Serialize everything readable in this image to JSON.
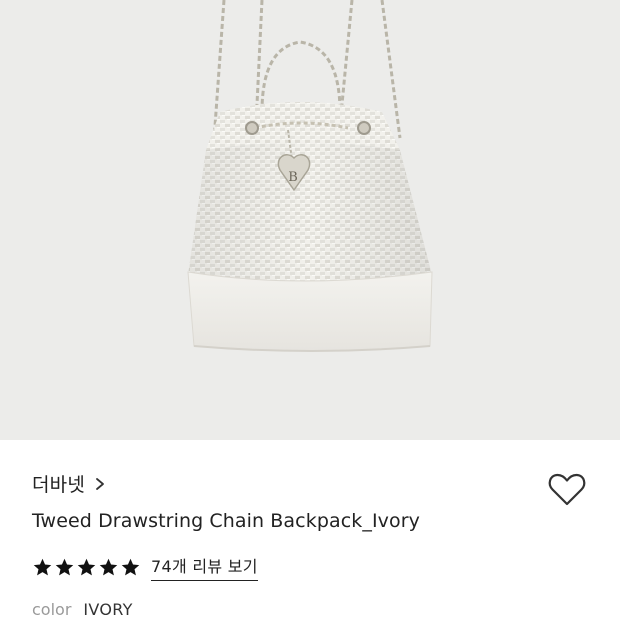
{
  "product_image": {
    "alt": "",
    "background": "#ececea",
    "pendant_letter": "B"
  },
  "brand": {
    "name": "더바넷",
    "chevron_icon": "chevron-right-icon"
  },
  "wishlist": {
    "icon": "heart-outline-icon"
  },
  "product": {
    "title": "Tweed Drawstring Chain Backpack_Ivory"
  },
  "rating": {
    "stars": 5,
    "max_stars": 5,
    "star_icon": "star-filled-icon",
    "review_link_label": "74개 리뷰 보기"
  },
  "option": {
    "label": "color",
    "value": "IVORY"
  }
}
